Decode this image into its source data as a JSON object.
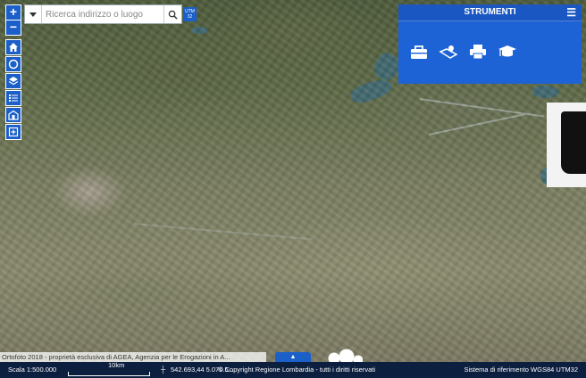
{
  "search": {
    "placeholder": "Ricerca indirizzo o luogo",
    "utm_label": "UTM 32"
  },
  "map_controls": {
    "zoom_in": "+",
    "zoom_out": "−",
    "buttons": [
      "home-icon",
      "circle-select-icon",
      "layers-icon",
      "legend-list-icon",
      "building-icon",
      "add-frame-icon"
    ]
  },
  "tools_panel": {
    "title": "STRUMENTI",
    "menu": "☰",
    "tools": [
      "toolbox-icon",
      "map-pin-icon",
      "printer-icon",
      "graduation-cap-icon"
    ]
  },
  "attribution": "Ortofoto 2018 - proprietà esclusiva di AGEA, Agenzia per le Erogazioni in A...",
  "footer": {
    "scale": "Scala 1:500.000",
    "scale_bar": "10km",
    "coords": "542.693,44 5.076.5...",
    "copyright": "© Copyright Regione Lombardia - tutti i diritti riservati",
    "crs": "Sistema di riferimento WGS84 UTM32"
  },
  "colors": {
    "accent": "#1b5fc8",
    "panel": "#1e63d6",
    "footer": "#0d1f3f"
  }
}
